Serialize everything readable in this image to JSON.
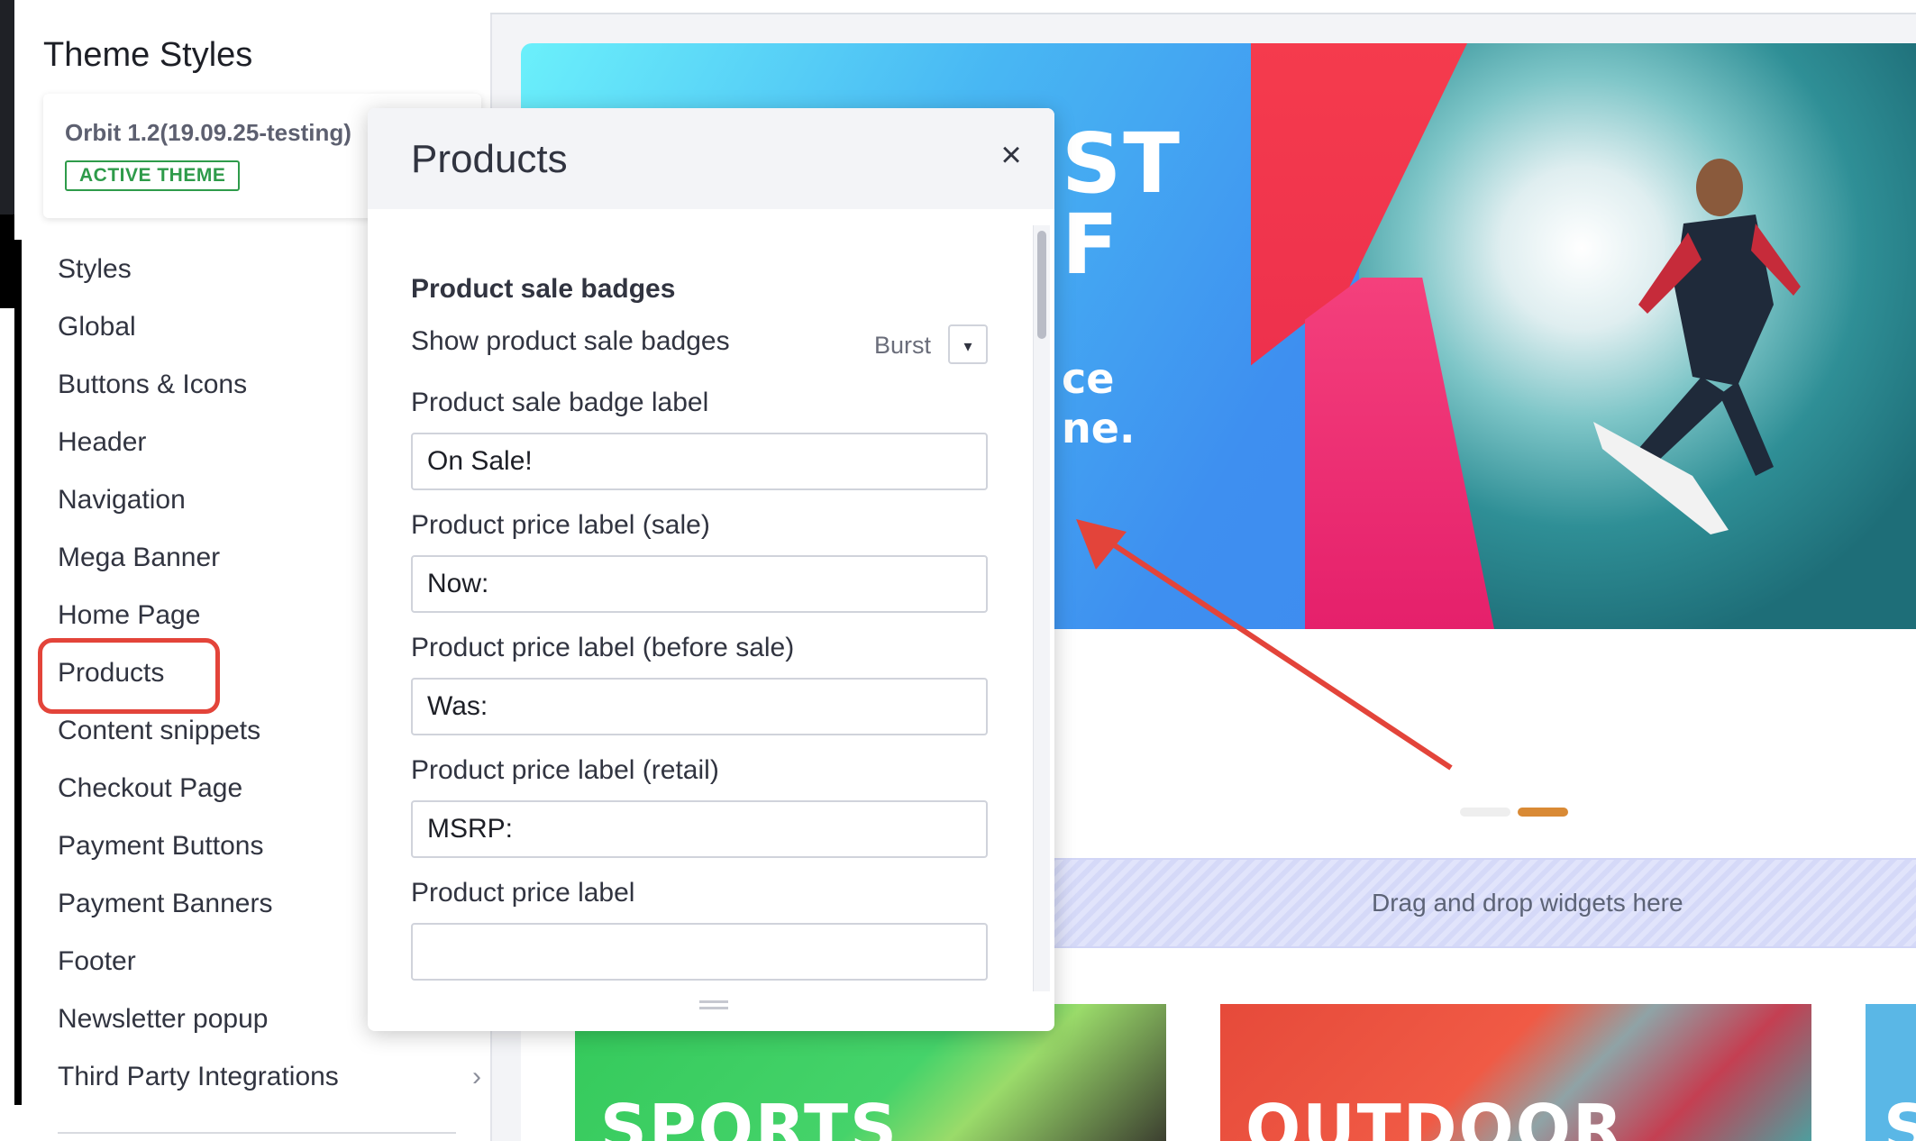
{
  "sidebar": {
    "title": "Theme Styles",
    "theme": {
      "name": "Orbit 1.2(19.09.25-testing)",
      "badge": "ACTIVE THEME"
    },
    "items": [
      {
        "label": "Styles"
      },
      {
        "label": "Global"
      },
      {
        "label": "Buttons & Icons"
      },
      {
        "label": "Header"
      },
      {
        "label": "Navigation"
      },
      {
        "label": "Mega Banner"
      },
      {
        "label": "Home Page"
      },
      {
        "label": "Products"
      },
      {
        "label": "Content snippets"
      },
      {
        "label": "Checkout Page"
      },
      {
        "label": "Payment Buttons"
      },
      {
        "label": "Payment Banners"
      },
      {
        "label": "Footer"
      },
      {
        "label": "Newsletter popup"
      },
      {
        "label": "Third Party Integrations"
      }
    ],
    "highlighted_item": "Products",
    "highlight_color": "#e3443a"
  },
  "modal": {
    "title": "Products",
    "close_icon": "×",
    "section_title": "Product sale badges",
    "show_badges": {
      "label": "Show product sale badges",
      "value": "Burst",
      "dropdown_icon": "▾"
    },
    "fields": [
      {
        "label": "Product sale badge label",
        "value": "On Sale!"
      },
      {
        "label": "Product price label (sale)",
        "value": "Now:"
      },
      {
        "label": "Product price label (before sale)",
        "value": "Was:"
      },
      {
        "label": "Product price label (retail)",
        "value": "MSRP:"
      },
      {
        "label": "Product price label",
        "value": ""
      }
    ]
  },
  "canvas": {
    "hero_text": [
      "ST",
      "F",
      "ce",
      "ne."
    ],
    "dropzone_text": "Drag and drop widgets here",
    "tiles": [
      "SPORTS",
      "OUTDOOR",
      "S"
    ],
    "carousel_active_color": "#d98a35"
  },
  "annotation": {
    "arrow_color": "#e3443a"
  }
}
